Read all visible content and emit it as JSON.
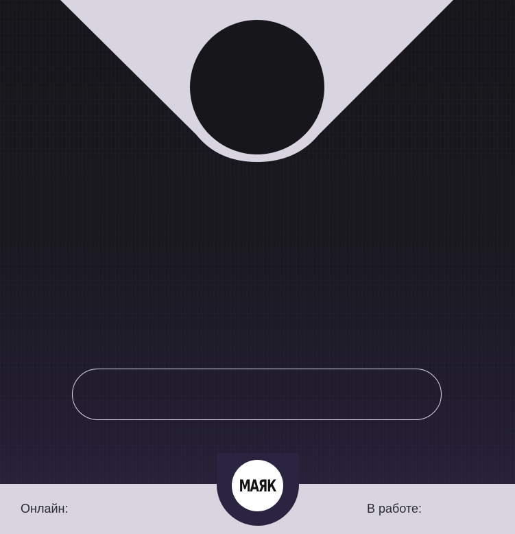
{
  "logo": {
    "text": "МАЯК"
  },
  "message_input": {
    "value": ""
  },
  "footer": {
    "online_label": "Онлайн:",
    "online_value": "",
    "in_work_label": "В работе:",
    "in_work_value": ""
  },
  "colors": {
    "background_dark": "#17161b",
    "background_bottom": "#2b2440",
    "panel_light": "#d8d5e0",
    "outline": "#dcd8e4",
    "logo_bg": "#ffffff"
  },
  "icons": {
    "avatar": "avatar-circle",
    "logo": "mayak-logo-icon"
  }
}
